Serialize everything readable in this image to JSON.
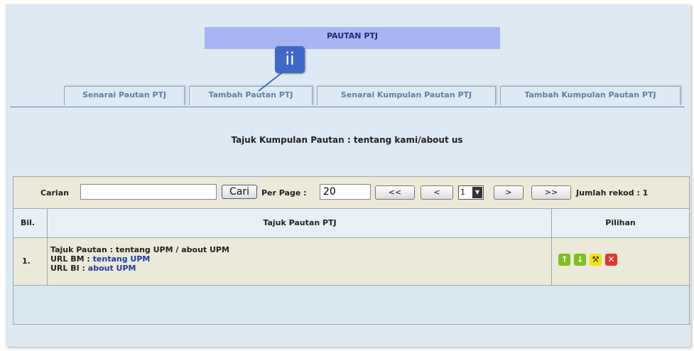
{
  "banner": {
    "title": "PAUTAN PTJ"
  },
  "callout": {
    "label": "ii"
  },
  "tabs": [
    {
      "label": "Senarai Pautan PTJ"
    },
    {
      "label": "Tambah Pautan PTJ"
    },
    {
      "label": "Senarai Kumpulan Pautan PTJ"
    },
    {
      "label": "Tambah Kumpulan Pautan PTJ"
    }
  ],
  "group_heading": "Tajuk Kumpulan Pautan : tentang kami/about us",
  "toolbar": {
    "search_label": "Carian",
    "search_value": "",
    "search_button": "Cari",
    "per_page_label": "Per Page :",
    "per_page_value": "20",
    "first_label": "<<",
    "prev_label": "<",
    "page_value": "1",
    "next_label": ">",
    "last_label": ">>",
    "total_label": "Jumlah rekod : 1"
  },
  "table": {
    "columns": [
      "Bil.",
      "Tajuk Pautan PTJ",
      "Pilihan"
    ],
    "rows": [
      {
        "num": "1.",
        "title_label": "Tajuk Pautan : tentang UPM / about UPM",
        "url_bm_label": "URL BM : ",
        "url_bm_link": "tentang UPM",
        "url_bi_label": "URL BI : ",
        "url_bi_link": "about UPM",
        "actions": [
          "up-arrow-icon",
          "down-arrow-icon",
          "edit-wrench-icon",
          "delete-icon"
        ]
      }
    ]
  },
  "colors": {
    "up": "#7dc11d",
    "down": "#7dc11d",
    "edit": "#f5e400",
    "delete": "#e3352b"
  }
}
